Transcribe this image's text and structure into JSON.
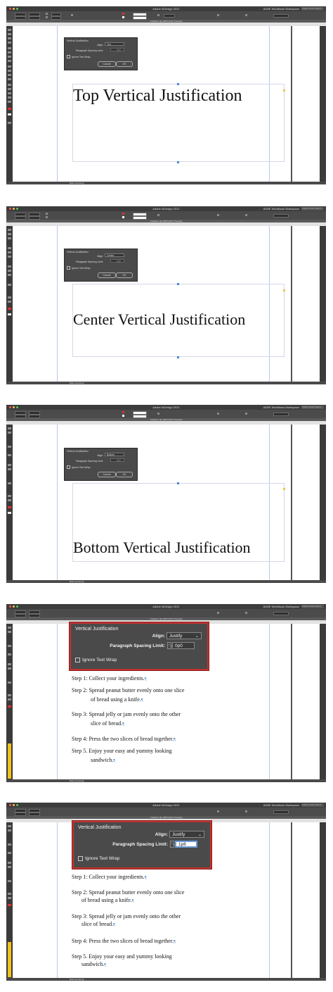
{
  "app": {
    "title": "Adobe InDesign 2021",
    "workspace": "ADBE Workflows Workspace",
    "search_placeholder": "Adobe Stock Search",
    "document_tab": "Untitled-1 @ 100% [GPU Preview]",
    "status": "Basic (working)",
    "page": "1"
  },
  "dialog": {
    "title": "Vertical Justification",
    "align_label": "Align:",
    "spacing_label": "Paragraph Spacing Limit:",
    "ignore_wrap_label": "Ignore Text Wrap",
    "cancel_label": "Cancel",
    "ok_label": "OK",
    "spinner_glyph": "⌃⌄"
  },
  "panels": [
    {
      "align": "Top",
      "spacing": "0p0",
      "headline": "Top Vertical Justification"
    },
    {
      "align": "Center",
      "spacing": "0p0",
      "headline": "Center Vertical Justification"
    },
    {
      "align": "Bottom",
      "spacing": "0p0",
      "headline": "Bottom Vertical Justification"
    },
    {
      "align": "Justify",
      "spacing": "0p0"
    },
    {
      "align": "Justify",
      "spacing": "1p6"
    }
  ],
  "steps": {
    "s1": "Step 1: Collect your ingredients.",
    "s2a": "Step 2: Spread peanut butter evenly onto one slice",
    "s2b": "of bread using a knife.",
    "s3a": "Step 3: Spread jelly or jam evenly onto the other",
    "s3b": "slice of bread.",
    "s4": "Step 4: Press the two slices of bread together.",
    "s5a": "Step 5. Enjoy your easy and yummy looking",
    "s5b": "sandwich.",
    "mark": "¶"
  },
  "colors": {
    "highlight": "#c0332f",
    "handle": "#4e86cc",
    "chrome": "#4b4b4b"
  }
}
